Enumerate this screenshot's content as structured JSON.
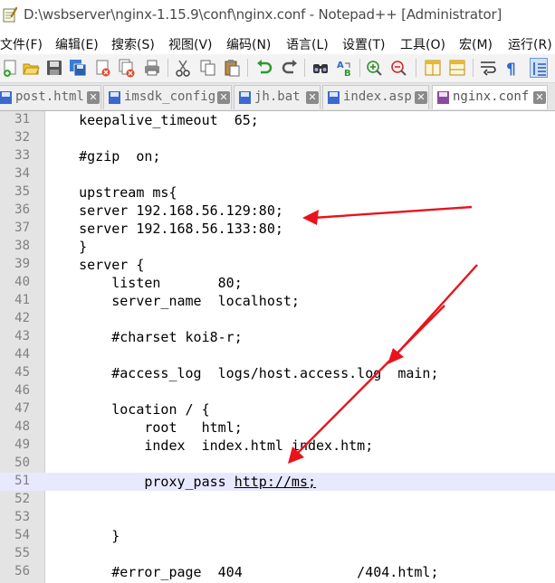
{
  "window": {
    "title": "D:\\wsbserver\\nginx-1.15.9\\conf\\nginx.conf - Notepad++ [Administrator]"
  },
  "menubar": {
    "items": [
      "文件(F)",
      "编辑(E)",
      "搜索(S)",
      "视图(V)",
      "编码(N)",
      "语言(L)",
      "设置(T)",
      "工具(O)",
      "宏(M)",
      "运行(R)"
    ]
  },
  "toolbar": {
    "icons": [
      "new-file-icon",
      "open-file-icon",
      "save-icon",
      "save-all-icon",
      "close-icon",
      "close-all-icon",
      "print-icon",
      "cut-icon",
      "copy-icon",
      "paste-icon",
      "undo-icon",
      "redo-icon",
      "find-icon",
      "replace-icon",
      "zoom-in-icon",
      "zoom-out-icon",
      "sync-vertical-icon",
      "sync-horizontal-icon",
      "word-wrap-icon",
      "show-all-chars-icon",
      "indent-guide-icon"
    ]
  },
  "tabs": [
    {
      "label": "post.html",
      "active": false
    },
    {
      "label": "imsdk_config",
      "active": false
    },
    {
      "label": "jh.bat",
      "active": false
    },
    {
      "label": "index.asp",
      "active": false
    },
    {
      "label": "nginx.conf",
      "active": true
    }
  ],
  "editor": {
    "current_line": 51,
    "lines": [
      {
        "num": "31",
        "text": "    keepalive_timeout  65;"
      },
      {
        "num": "32",
        "text": ""
      },
      {
        "num": "33",
        "text": "    #gzip  on;"
      },
      {
        "num": "34",
        "text": ""
      },
      {
        "num": "35",
        "text": "    upstream ms{"
      },
      {
        "num": "36",
        "text": "    server 192.168.56.129:80;"
      },
      {
        "num": "37",
        "text": "    server 192.168.56.133:80;"
      },
      {
        "num": "38",
        "text": "    }"
      },
      {
        "num": "39",
        "text": "    server {"
      },
      {
        "num": "40",
        "text": "        listen       80;"
      },
      {
        "num": "41",
        "text": "        server_name  localhost;"
      },
      {
        "num": "42",
        "text": ""
      },
      {
        "num": "43",
        "text": "        #charset koi8-r;"
      },
      {
        "num": "44",
        "text": ""
      },
      {
        "num": "45",
        "text": "        #access_log  logs/host.access.log  main;"
      },
      {
        "num": "46",
        "text": ""
      },
      {
        "num": "47",
        "text": "        location / {"
      },
      {
        "num": "48",
        "text": "            root   html;"
      },
      {
        "num": "49",
        "text": "            index  index.html index.htm;"
      },
      {
        "num": "50",
        "text": ""
      },
      {
        "num": "51",
        "text": "            proxy_pass ",
        "url": "http://ms;"
      },
      {
        "num": "52",
        "text": ""
      },
      {
        "num": "53",
        "text": ""
      },
      {
        "num": "54",
        "text": "        }"
      },
      {
        "num": "55",
        "text": ""
      },
      {
        "num": "56",
        "text": "        #error_page  404              /404.html;"
      }
    ]
  },
  "colors": {
    "annotation_arrow": "#e8141b",
    "current_line_bg": "#e8e8ff",
    "gutter_bg": "#e4e4e4"
  }
}
